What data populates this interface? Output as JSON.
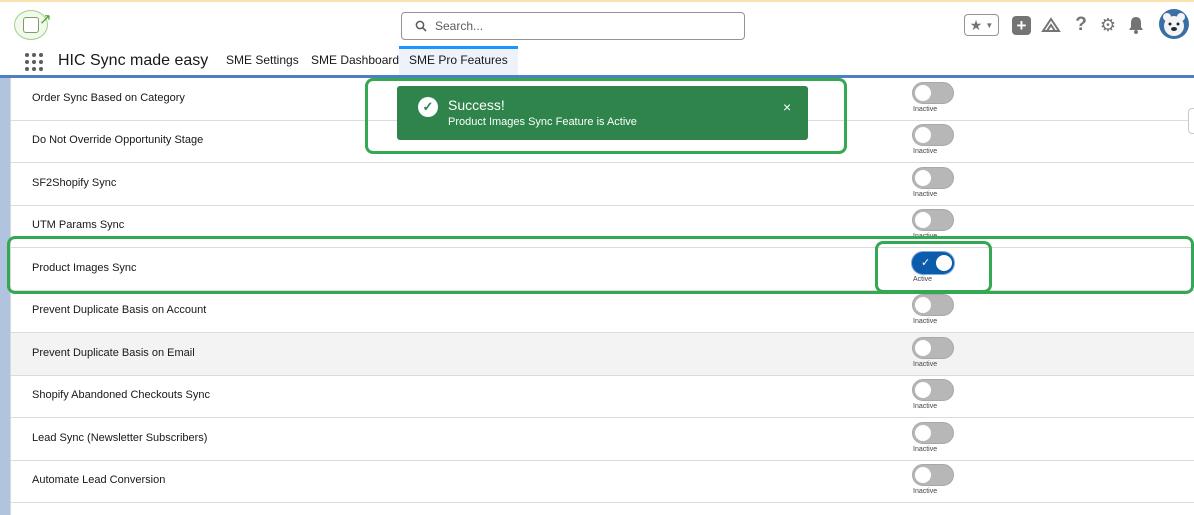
{
  "header": {
    "search_placeholder": "Search...",
    "icons": [
      "star-icon",
      "chevron-down-icon",
      "add-icon",
      "trailhead-icon",
      "help-icon",
      "gear-icon",
      "bell-icon",
      "avatar"
    ]
  },
  "nav": {
    "app_name": "HIC Sync made easy",
    "tabs": [
      {
        "label": "SME Settings",
        "active": false
      },
      {
        "label": "SME Dashboard",
        "active": false
      },
      {
        "label": "SME Pro Features",
        "active": true
      }
    ]
  },
  "toast": {
    "title": "Success!",
    "message": "Product Images Sync Feature is Active",
    "close_glyph": "×",
    "color": "#2e844a"
  },
  "features": [
    {
      "label": "Order Sync Based on Category",
      "state": "Inactive",
      "on": false
    },
    {
      "label": "Do Not Override Opportunity Stage",
      "state": "Inactive",
      "on": false
    },
    {
      "label": "SF2Shopify Sync",
      "state": "Inactive",
      "on": false
    },
    {
      "label": "UTM Params Sync",
      "state": "Inactive",
      "on": false
    },
    {
      "label": "Product Images Sync",
      "state": "Active",
      "on": true
    },
    {
      "label": "Prevent Duplicate Basis on Account",
      "state": "Inactive",
      "on": false
    },
    {
      "label": "Prevent Duplicate Basis on Email",
      "state": "Inactive",
      "on": false
    },
    {
      "label": "Shopify Abandoned Checkouts Sync",
      "state": "Inactive",
      "on": false
    },
    {
      "label": "Lead Sync (Newsletter Subscribers)",
      "state": "Inactive",
      "on": false
    },
    {
      "label": "Automate Lead Conversion",
      "state": "Inactive",
      "on": false
    }
  ],
  "colors": {
    "brand": "#0b5cab",
    "highlight": "#34a853",
    "toggle_off": "#b7b7b7"
  }
}
